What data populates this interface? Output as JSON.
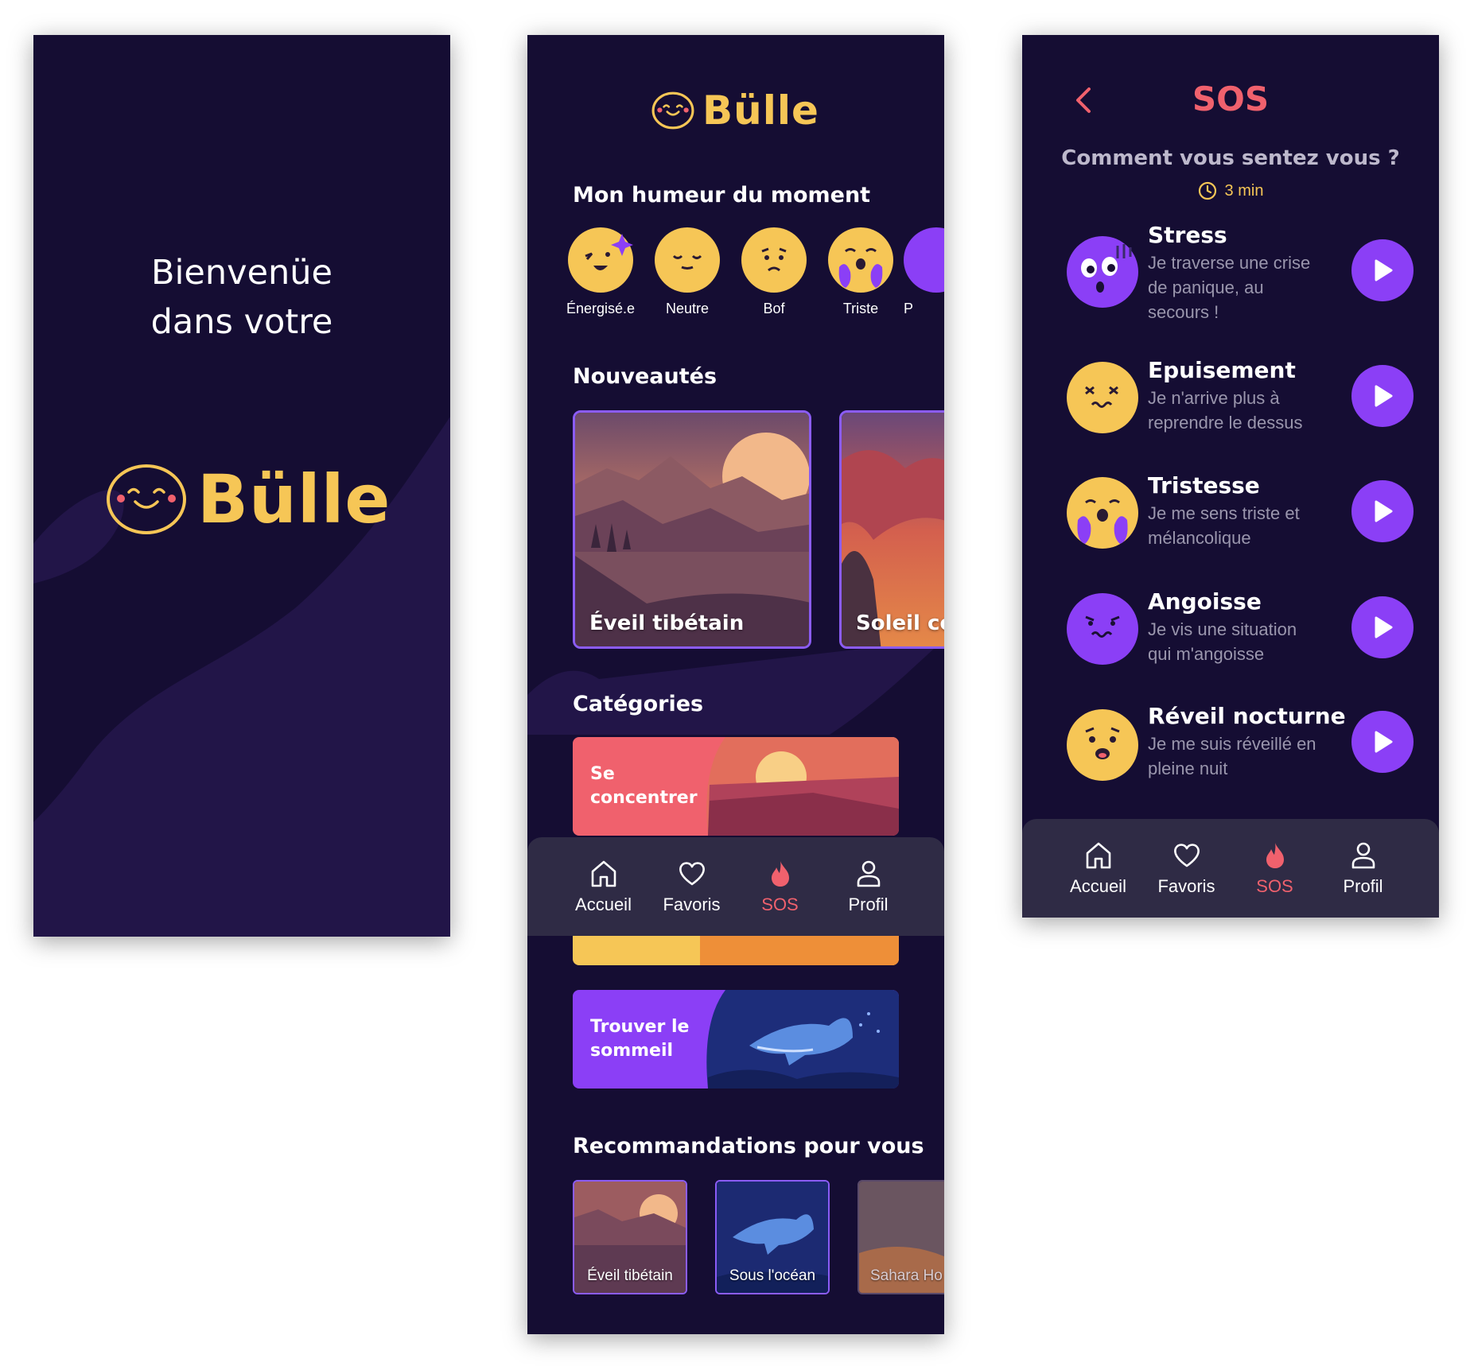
{
  "colors": {
    "background": "#150d33",
    "accent_yellow": "#f6c656",
    "accent_purple": "#8b3ff6",
    "accent_red": "#f0616d",
    "navbar": "#2f2b45"
  },
  "splash": {
    "welcome": "Bienvenüe dans votre",
    "brand": "Bülle"
  },
  "home": {
    "brand": "Bülle",
    "mood_title": "Mon humeur du moment",
    "moods": [
      {
        "label": "Énergisé.e",
        "icon": "energized-face-icon"
      },
      {
        "label": "Neutre",
        "icon": "neutral-face-icon"
      },
      {
        "label": "Bof",
        "icon": "meh-face-icon"
      },
      {
        "label": "Triste",
        "icon": "sad-face-icon"
      },
      {
        "label": "P",
        "icon": "partial-face-icon"
      }
    ],
    "news_title": "Nouveautés",
    "news": [
      {
        "label": "Éveil tibétain"
      },
      {
        "label": "Soleil co"
      }
    ],
    "categories_title": "Catégories",
    "categories": [
      {
        "label": "Se concentrer"
      },
      {
        "label": "Trouver le sommeil"
      }
    ],
    "recommendations_title": "Recommandations pour vous",
    "recommendations": [
      {
        "label": "Éveil tibétain"
      },
      {
        "label": "Sous l'océan"
      },
      {
        "label": "Sahara Ho"
      }
    ]
  },
  "nav": {
    "items": [
      {
        "label": "Accueil",
        "icon": "home-icon"
      },
      {
        "label": "Favoris",
        "icon": "heart-icon"
      },
      {
        "label": "SOS",
        "icon": "flame-icon"
      },
      {
        "label": "Profil",
        "icon": "user-icon"
      }
    ],
    "active": "SOS"
  },
  "sos": {
    "title": "SOS",
    "question": "Comment vous sentez vous ?",
    "duration": "3 min",
    "items": [
      {
        "name": "Stress",
        "desc": "Je traverse une crise de panique, au secours !"
      },
      {
        "name": "Epuisement",
        "desc": "Je n'arrive plus à reprendre  le dessus"
      },
      {
        "name": "Tristesse",
        "desc": "Je me sens triste et mélancolique"
      },
      {
        "name": "Angoisse",
        "desc": "Je vis une situation qui m'angoisse"
      },
      {
        "name": "Réveil nocturne",
        "desc": "Je me suis réveillé en pleine nuit"
      }
    ]
  }
}
